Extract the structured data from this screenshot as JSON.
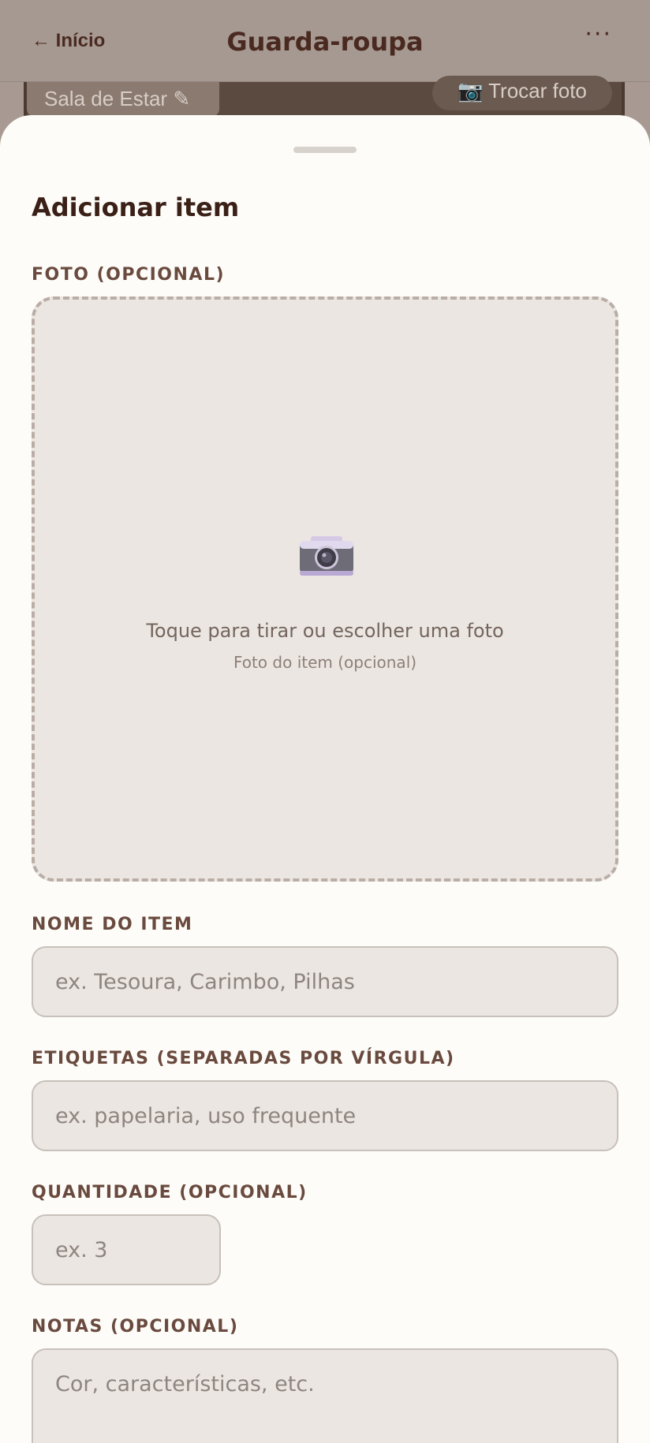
{
  "header": {
    "back_label": "← Início",
    "title": "Guarda-roupa",
    "more_label": "···"
  },
  "background": {
    "room_chip": "Sala de Estar ✎",
    "swap_photo": "📷 Trocar foto"
  },
  "sheet": {
    "title": "Adicionar item",
    "photo": {
      "label": "FOTO (OPCIONAL)",
      "icon": "camera-icon",
      "prompt": "Toque para tirar ou escolher uma foto",
      "hint": "Foto do item (opcional)"
    },
    "name": {
      "label": "NOME DO ITEM",
      "value": "",
      "placeholder": "ex. Tesoura, Carimbo, Pilhas"
    },
    "tags": {
      "label": "ETIQUETAS (SEPARADAS POR VÍRGULA)",
      "value": "",
      "placeholder": "ex. papelaria, uso frequente"
    },
    "quantity": {
      "label": "QUANTIDADE (OPCIONAL)",
      "value": "",
      "placeholder": "ex. 3"
    },
    "notes": {
      "label": "NOTAS (OPCIONAL)",
      "value": "",
      "placeholder": "Cor, características, etc."
    }
  }
}
